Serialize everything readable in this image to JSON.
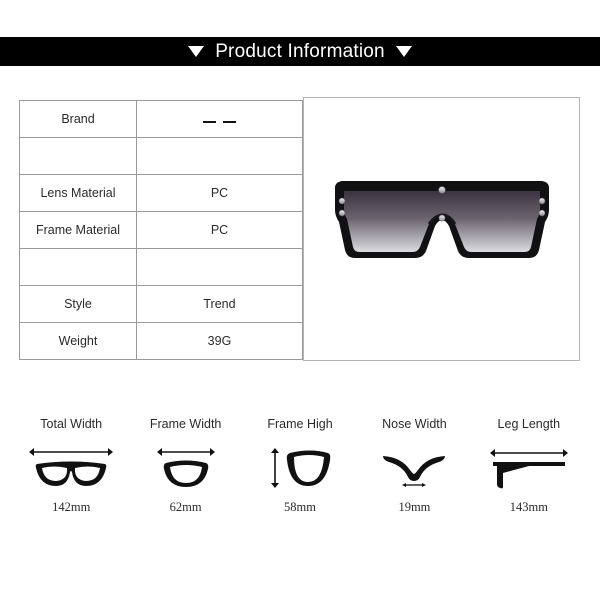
{
  "header": {
    "title": "Product Information",
    "left_icon": "triangle-down-icon",
    "right_icon": "triangle-down-icon",
    "background_color": "#000000",
    "text_color": "#ffffff"
  },
  "spec_table": {
    "rows": [
      {
        "label": "Brand",
        "value": "— —",
        "value_is_dashes": true
      },
      {
        "label": "",
        "value": "",
        "value_is_dashes": false
      },
      {
        "label": "Lens Material",
        "value": "PC",
        "value_is_dashes": false
      },
      {
        "label": "Frame Material",
        "value": "PC",
        "value_is_dashes": false
      },
      {
        "label": "",
        "value": "",
        "value_is_dashes": false
      },
      {
        "label": "Style",
        "value": "Trend",
        "value_is_dashes": false
      },
      {
        "label": "Weight",
        "value": "39G",
        "value_is_dashes": false
      }
    ],
    "border_color": "#9b9b9b"
  },
  "product_image": {
    "alt": "Oversized flat-top shield sunglasses, black frame with gradient lens",
    "frame_color": "#111111",
    "lens_gradient_top": "#3a3340",
    "lens_gradient_bottom": "#d8d8dc",
    "rivet_color": "#c9c9cf",
    "border_color": "#b4b4b4"
  },
  "measurements": [
    {
      "label": "Total Width",
      "value": "142mm",
      "icon": "total-width-icon"
    },
    {
      "label": "Frame Width",
      "value": "62mm",
      "icon": "frame-width-icon"
    },
    {
      "label": "Frame High",
      "value": "58mm",
      "icon": "frame-height-icon"
    },
    {
      "label": "Nose Width",
      "value": "19mm",
      "icon": "nose-width-icon"
    },
    {
      "label": "Leg Length",
      "value": "143mm",
      "icon": "leg-length-icon"
    }
  ]
}
